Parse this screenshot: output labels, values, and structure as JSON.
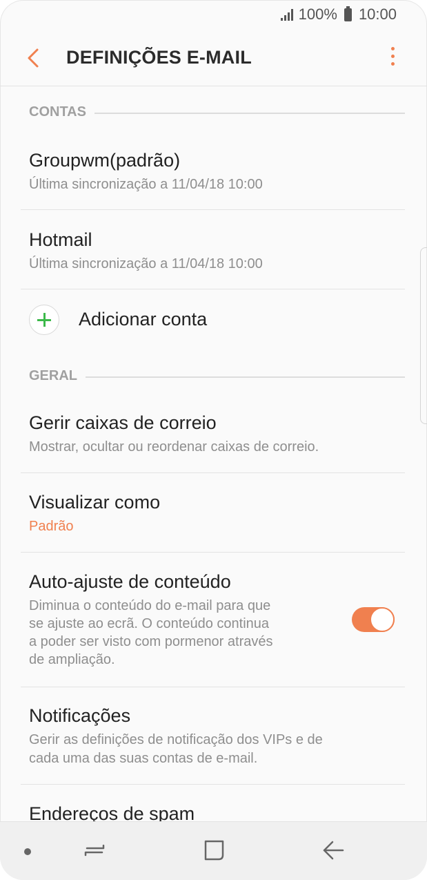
{
  "status_bar": {
    "battery": "100%",
    "time": "10:00"
  },
  "header": {
    "title": "DEFINIÇÕES E-MAIL"
  },
  "sections": {
    "accounts": "CONTAS",
    "general": "GERAL"
  },
  "accounts": [
    {
      "name": "Groupwm(padrão)",
      "sync": "Última sincronização a 11/04/18  10:00"
    },
    {
      "name": "Hotmail",
      "sync": "Última sincronização a 11/04/18  10:00"
    }
  ],
  "add_account": {
    "label": "Adicionar conta"
  },
  "general": {
    "mailboxes": {
      "title": "Gerir caixas de correio",
      "sub": "Mostrar, ocultar ou reordenar caixas de correio."
    },
    "view_as": {
      "title": "Visualizar como",
      "value": "Padrão"
    },
    "auto_fit": {
      "title": "Auto-ajuste de conteúdo",
      "sub_lines": [
        "Diminua o conteúdo do e-mail para que",
        "se ajuste ao ecrã. O conteúdo continua",
        "a poder ser visto com pormenor através",
        "de ampliação."
      ],
      "enabled": true
    },
    "notifications": {
      "title": "Notificações",
      "sub_lines": [
        "Gerir as definições de notificação dos VIPs e de",
        "cada uma das suas contas de e-mail."
      ]
    },
    "spam": {
      "title": "Endereços de spam"
    }
  },
  "colors": {
    "accent": "#f0804f",
    "add_icon": "#3cb94a",
    "background": "#fafafa"
  }
}
